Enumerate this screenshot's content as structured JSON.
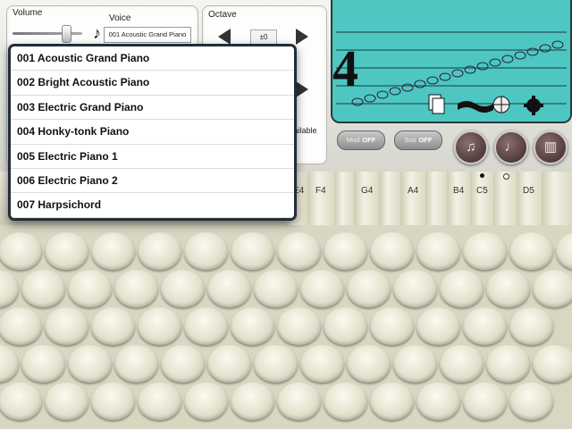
{
  "controls": {
    "volume_label": "Volume",
    "voice_label": "Voice",
    "voice_value": "001 Acoustic Grand Piano",
    "octave_label": "Octave",
    "octave_value": "±0",
    "available_text": "vailable"
  },
  "display": {
    "time_signature": "4"
  },
  "toggles": {
    "mod_label": "Mod",
    "mod_state": "OFF",
    "sus_label": "Sus",
    "sus_state": "OFF"
  },
  "keys": [
    "E4",
    "F4",
    "G4",
    "A4",
    "B4",
    "C5",
    "D5"
  ],
  "voice_list": {
    "items": [
      "001 Acoustic Grand Piano",
      "002 Bright Acoustic Piano",
      "003 Electric Grand Piano",
      "004 Honky-tonk Piano",
      "005 Electric Piano 1",
      "006 Electric Piano 2",
      "007 Harpsichord"
    ]
  },
  "colors": {
    "screen": "#4ec6c2",
    "popover_border": "#222d3a"
  },
  "icons": [
    "music-note-icon",
    "arrow-left-icon",
    "arrow-right-icon",
    "document-icon",
    "film-strip-icon",
    "globe-icon",
    "gear-icon",
    "staff-note-icon",
    "piano-keys-icon",
    "accordion-icon"
  ]
}
